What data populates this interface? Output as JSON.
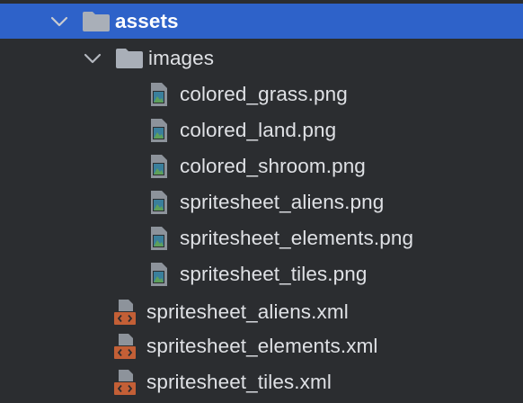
{
  "colors": {
    "background": "#2b2d30",
    "selection": "#2e62c9",
    "folder": "#a9afb8",
    "text": "#dfe1e5",
    "xml_badge": "#c35f36"
  },
  "tree": {
    "root": {
      "label": "assets",
      "icon": "folder-icon",
      "expanded": true,
      "selected": true
    },
    "images_folder": {
      "label": "images",
      "icon": "folder-icon",
      "expanded": true
    },
    "image_files": [
      {
        "label": "colored_grass.png",
        "icon": "image-file-icon"
      },
      {
        "label": "colored_land.png",
        "icon": "image-file-icon"
      },
      {
        "label": "colored_shroom.png",
        "icon": "image-file-icon"
      },
      {
        "label": "spritesheet_aliens.png",
        "icon": "image-file-icon"
      },
      {
        "label": "spritesheet_elements.png",
        "icon": "image-file-icon"
      },
      {
        "label": "spritesheet_tiles.png",
        "icon": "image-file-icon"
      }
    ],
    "xml_files": [
      {
        "label": "spritesheet_aliens.xml",
        "icon": "xml-file-icon"
      },
      {
        "label": "spritesheet_elements.xml",
        "icon": "xml-file-icon"
      },
      {
        "label": "spritesheet_tiles.xml",
        "icon": "xml-file-icon"
      }
    ]
  }
}
